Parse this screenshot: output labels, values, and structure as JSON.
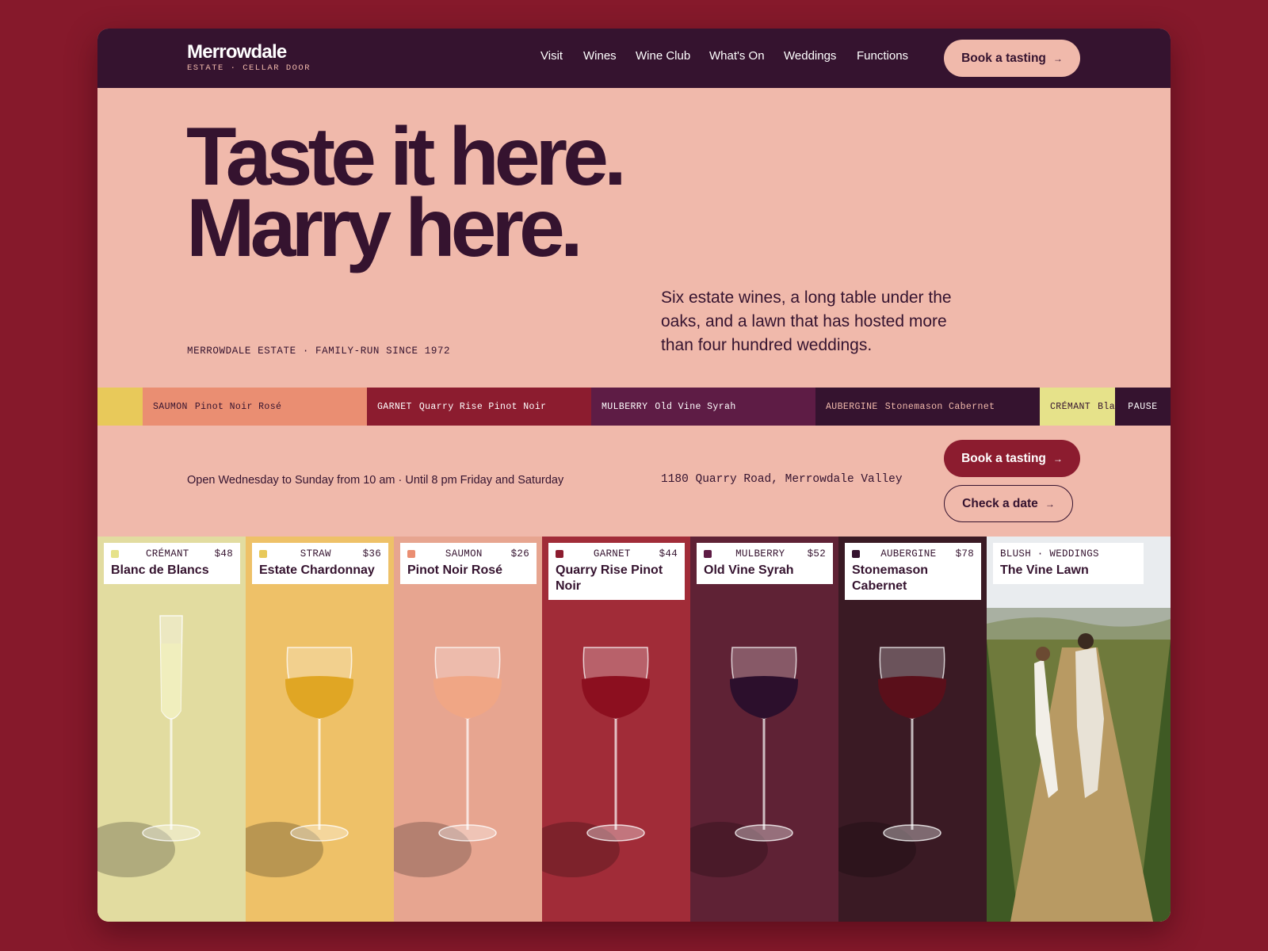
{
  "brand": {
    "name": "Merrowdale",
    "subtitle": "ESTATE · CELLAR DOOR"
  },
  "nav": {
    "items": [
      "Visit",
      "Wines",
      "Wine Club",
      "What's On",
      "Weddings",
      "Functions"
    ],
    "cta": "Book a tasting"
  },
  "hero": {
    "headline_line1": "Taste it here.",
    "headline_line2": "Marry here.",
    "meta": "MERROWDALE ESTATE · FAMILY-RUN SINCE 1972",
    "blurb": "Six estate wines, a long table under the oaks, and a lawn that has hosted more than four hundred weddings."
  },
  "strip": {
    "swatches": [
      {
        "tone": "",
        "wine": "",
        "color": "#e8c95a",
        "text_color": "#35132f"
      },
      {
        "tone": "SAUMON",
        "wine": "Pinot Noir Rosé",
        "color": "#ea8e72",
        "text_color": "#35132f"
      },
      {
        "tone": "GARNET",
        "wine": "Quarry Rise Pinot Noir",
        "color": "#8c1c2f",
        "text_color": "#ffffff"
      },
      {
        "tone": "MULBERRY",
        "wine": "Old Vine Syrah",
        "color": "#5e1c45",
        "text_color": "#ffffff"
      },
      {
        "tone": "AUBERGINE",
        "wine": "Stonemason Cabernet",
        "color": "#35132f",
        "text_color": "#f0b9ab"
      },
      {
        "tone": "CRÉMANT",
        "wine": "Blanc de Blancs",
        "color": "#e6e28a",
        "text_color": "#35132f"
      }
    ],
    "pause_label": "PAUSE"
  },
  "info": {
    "hours": "Open Wednesday to Sunday from 10 am · Until 8 pm Friday and Saturday",
    "address": "1180 Quarry Road, Merrowdale Valley",
    "primary_cta": "Book a tasting",
    "secondary_cta": "Check a date"
  },
  "cards": [
    {
      "tone": "CRÉMANT",
      "price": "$48",
      "name": "Blanc de Blancs",
      "dot": "#e6e28a",
      "bg": "#e2dca0",
      "wine": "#f1eebc"
    },
    {
      "tone": "STRAW",
      "price": "$36",
      "name": "Estate Chardonnay",
      "dot": "#e8c95a",
      "bg": "#eec168",
      "wine": "#e0a624"
    },
    {
      "tone": "SAUMON",
      "price": "$26",
      "name": "Pinot Noir Rosé",
      "dot": "#ea8e72",
      "bg": "#e7a590",
      "wine": "#f0a685"
    },
    {
      "tone": "GARNET",
      "price": "$44",
      "name": "Quarry Rise Pinot Noir",
      "dot": "#8c1c2f",
      "bg": "#a12c38",
      "wine": "#8c0f1f"
    },
    {
      "tone": "MULBERRY",
      "price": "$52",
      "name": "Old Vine Syrah",
      "dot": "#5e1c45",
      "bg": "#5f2235",
      "wine": "#2c0f2c"
    },
    {
      "tone": "AUBERGINE",
      "price": "$78",
      "name": "Stonemason Cabernet",
      "dot": "#35132f",
      "bg": "#3a1a24",
      "wine": "#5a0f1a"
    },
    {
      "tone": "BLUSH · WEDDINGS",
      "price": "",
      "name": "The Vine Lawn",
      "dot": "",
      "bg": "#7d8a4e",
      "wine": ""
    }
  ],
  "icons": {
    "arrow": "arrow-right-icon",
    "wine_glass": "wine-glass-icon"
  },
  "colors": {
    "page_bg": "#86192b",
    "nav_bg": "#35132f",
    "hero_bg": "#f0b9ab",
    "ink": "#35132f",
    "accent": "#8c1c2f"
  }
}
